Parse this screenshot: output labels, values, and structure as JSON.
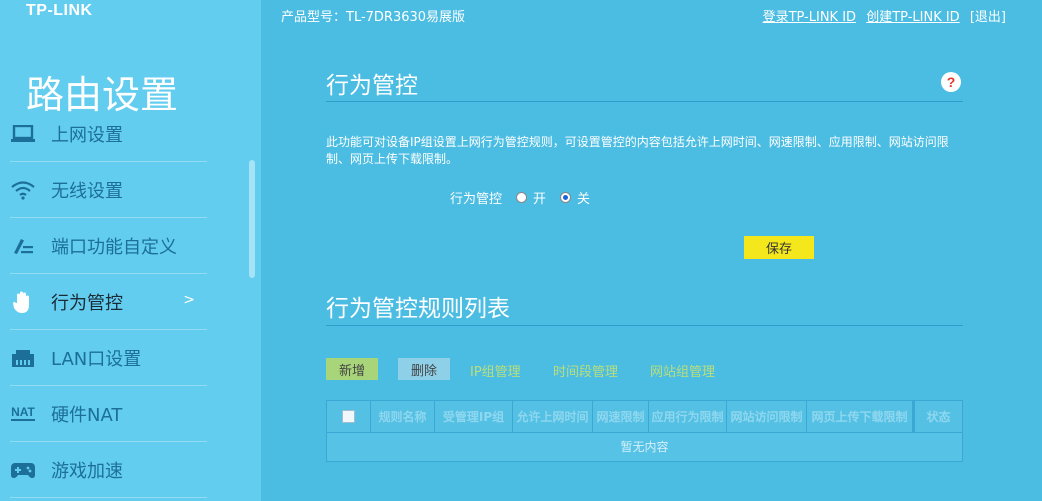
{
  "header": {
    "logo": "TP-LINK",
    "model": "产品型号：TL-7DR3630易展版",
    "login": "登录TP-LINK ID",
    "create": "创建TP-LINK ID",
    "logout": "[退出]"
  },
  "sidebar": {
    "title": "路由设置",
    "items": [
      {
        "label": "上网设置",
        "icon": "laptop-icon"
      },
      {
        "label": "无线设置",
        "icon": "wifi-icon"
      },
      {
        "label": "端口功能自定义",
        "icon": "edit-icon"
      },
      {
        "label": "行为管控",
        "icon": "hand-icon",
        "active": true,
        "arrow": ">"
      },
      {
        "label": "LAN口设置",
        "icon": "lan-port-icon"
      },
      {
        "label": "硬件NAT",
        "icon": "nat-icon"
      },
      {
        "label": "游戏加速",
        "icon": "gamepad-icon"
      }
    ],
    "nat_icon_text": "NAT"
  },
  "control": {
    "title": "行为管控",
    "help": "?",
    "description": "此功能可对设备IP组设置上网行为管控规则，可设置管控的内容包括允许上网时间、网速限制、应用限制、网站访问限制、网页上传下载限制。",
    "toggle_label": "行为管控",
    "on_label": "开",
    "off_label": "关",
    "selected": "off",
    "save_label": "保存"
  },
  "rules": {
    "title": "行为管控规则列表",
    "add_label": "新增",
    "delete_label": "删除",
    "links": [
      "IP组管理",
      "时间段管理",
      "网站组管理"
    ],
    "columns": [
      "规则名称",
      "受管理IP组",
      "允许上网时间",
      "网速限制",
      "应用行为限制",
      "网站访问限制",
      "网页上传下载限制",
      "状态"
    ],
    "empty_text": "暂无内容"
  },
  "colors": {
    "background": "#4bbde2",
    "sidebar": "#63cdf0",
    "save_button": "#f4e81c",
    "add_button": "#a8d57a",
    "delete_button": "#8ed0e8",
    "link": "#b9de7c",
    "help_icon": "#e03a2f"
  }
}
